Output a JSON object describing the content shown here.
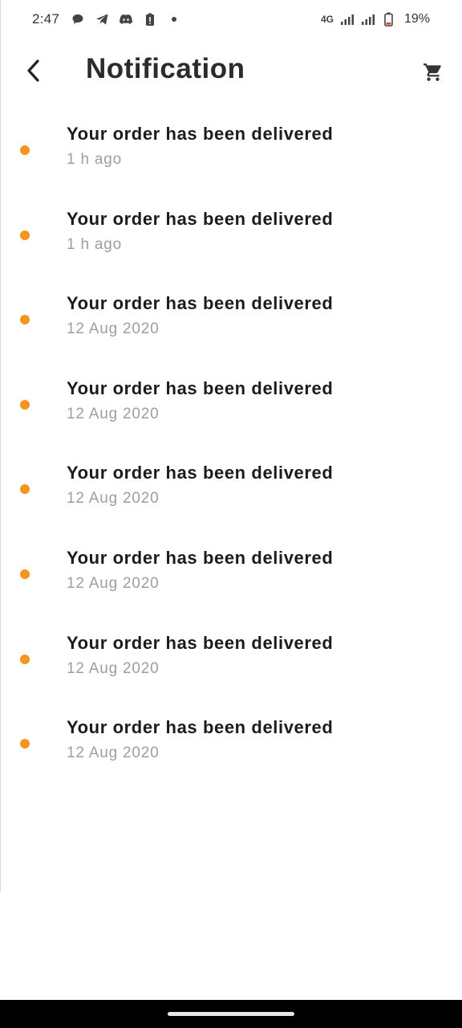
{
  "status_bar": {
    "time": "2:47",
    "network": "4G",
    "battery": "19%",
    "icons": [
      "chat-bubble-icon",
      "telegram-icon",
      "discord-icon",
      "battery-alert-icon",
      "dot-icon",
      "signal-icon",
      "signal-icon",
      "battery-icon"
    ]
  },
  "header": {
    "title": "Notification",
    "back_icon": "chevron-left-icon",
    "cart_icon": "cart-icon"
  },
  "notifications": [
    {
      "title": "Your order has been delivered",
      "time": "1 h ago"
    },
    {
      "title": "Your order has been delivered",
      "time": "1 h ago"
    },
    {
      "title": "Your order has been delivered",
      "time": "12 Aug 2020"
    },
    {
      "title": "Your order has been delivered",
      "time": "12 Aug 2020"
    },
    {
      "title": "Your order has been delivered",
      "time": "12 Aug 2020"
    },
    {
      "title": "Your order has been delivered",
      "time": "12 Aug 2020"
    },
    {
      "title": "Your order has been delivered",
      "time": "12 Aug 2020"
    },
    {
      "title": "Your order has been delivered",
      "time": "12 Aug 2020"
    }
  ],
  "colors": {
    "unread_dot": "#f7941d",
    "title_text": "#1c1c1c",
    "time_text": "#9e9e9e"
  }
}
